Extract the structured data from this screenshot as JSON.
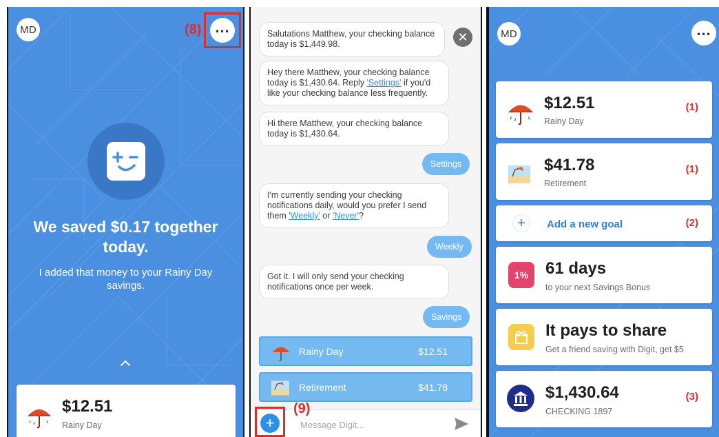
{
  "panel1": {
    "avatar": "MD",
    "annotation_8": "(8)",
    "headline": "We saved $0.17 together today.",
    "subline": "I added that money to your Rainy Day savings.",
    "card": {
      "amount": "$12.51",
      "label": "Rainy Day"
    }
  },
  "panel2": {
    "messages": [
      "Salutations Matthew, your checking balance today is $1,449.98.",
      "Hey there Matthew, your checking balance today is $1,430.64. Reply ",
      "Hi there Matthew, your checking balance today is $1,430.64.",
      "I'm currently sending your checking notifications daily, would you prefer I send them ",
      "Got it. I will only send your checking notifications once per week."
    ],
    "msg2_link": "'Settings'",
    "msg2_tail": " if you'd like your checking balance less frequently.",
    "msg4_link1": "'Weekly'",
    "msg4_mid": " or ",
    "msg4_link2": "'Never'",
    "msg4_tail": "?",
    "replies": [
      "Settings",
      "Weekly",
      "Savings"
    ],
    "goals": [
      {
        "label": "Rainy Day",
        "value": "$12.51"
      },
      {
        "label": "Retirement",
        "value": "$41.78"
      }
    ],
    "annotation_9": "(9)",
    "input_placeholder": "Message Digit..."
  },
  "panel3": {
    "avatar": "MD",
    "cards": [
      {
        "amount": "$12.51",
        "label": "Rainy Day",
        "annot": "(1)"
      },
      {
        "amount": "$41.78",
        "label": "Retirement",
        "annot": "(1)"
      }
    ],
    "add_goal": {
      "label": "Add a new goal",
      "annot": "(2)"
    },
    "bonus": {
      "badge": "1%",
      "title": "61 days",
      "sub": "to your next Savings Bonus"
    },
    "share": {
      "title": "It pays to share",
      "sub": "Get a friend saving with Digit, get $5"
    },
    "checking": {
      "amount": "$1,430.64",
      "label": "CHECKING 1897",
      "annot": "(3)"
    }
  },
  "colors": {
    "brand_blue": "#4a8fe0",
    "bubble_blue": "#74baf0",
    "annotation_red": "#d9302a",
    "bonus_pink": "#e2446c",
    "share_yellow": "#f5cc4c",
    "bank_navy": "#1f2d8a"
  }
}
